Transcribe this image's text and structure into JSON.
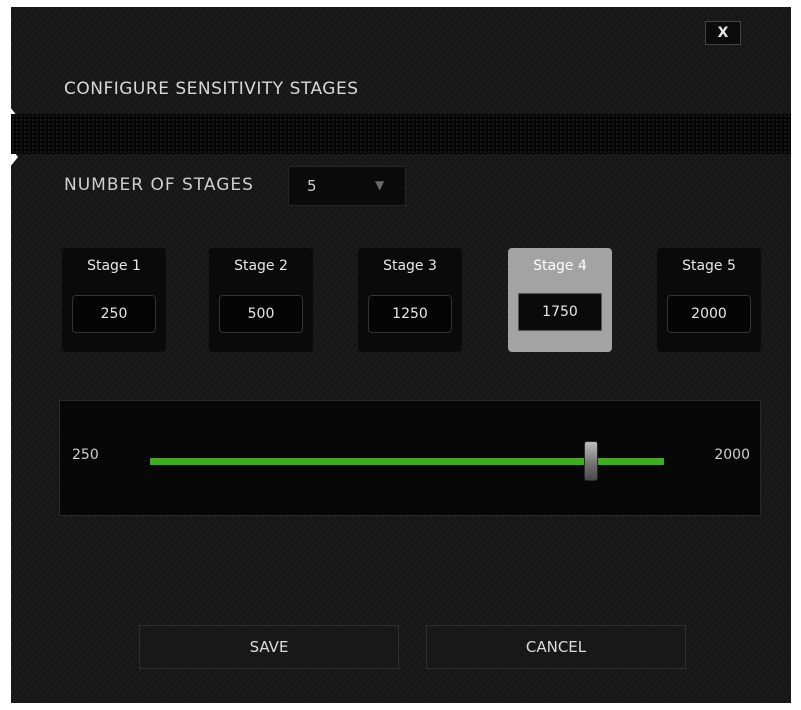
{
  "dialog": {
    "title": "CONFIGURE SENSITIVITY STAGES",
    "close_label": "X"
  },
  "number_of_stages": {
    "label": "NUMBER OF STAGES",
    "selected": "5",
    "caret_icon": "triangle-down-icon"
  },
  "stages": [
    {
      "label": "Stage 1",
      "value": "250",
      "active": false
    },
    {
      "label": "Stage 2",
      "value": "500",
      "active": false
    },
    {
      "label": "Stage 3",
      "value": "1250",
      "active": false
    },
    {
      "label": "Stage 4",
      "value": "1750",
      "active": true
    },
    {
      "label": "Stage 5",
      "value": "2000",
      "active": false
    }
  ],
  "slider": {
    "min_label": "250",
    "max_label": "2000",
    "min": 250,
    "max": 2000,
    "value": 1750,
    "track_color": "#3cb01c"
  },
  "buttons": {
    "save": "SAVE",
    "cancel": "CANCEL"
  }
}
